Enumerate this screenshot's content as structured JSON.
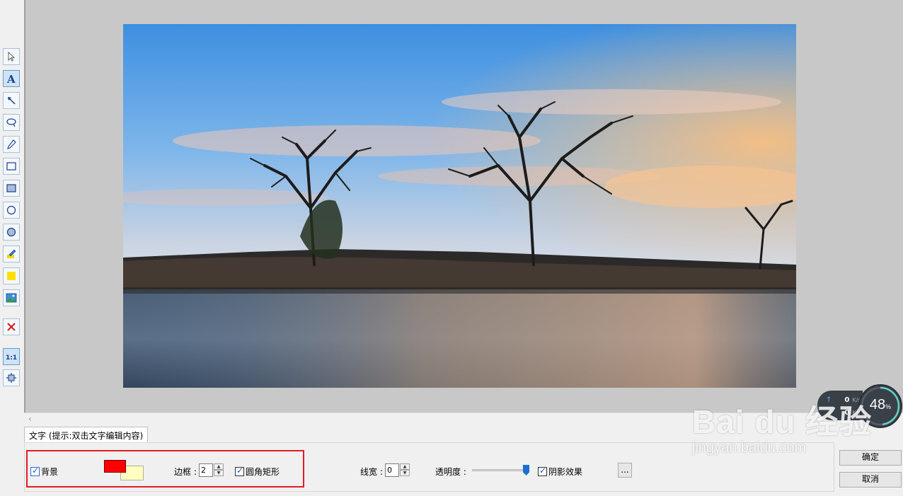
{
  "toolbar": {
    "tools": [
      {
        "id": "select",
        "icon": "cursor-icon"
      },
      {
        "id": "text",
        "icon": "text-icon",
        "active": true
      },
      {
        "id": "arrow",
        "icon": "arrow-icon"
      },
      {
        "id": "ellipse-callout",
        "icon": "lasso-icon"
      },
      {
        "id": "pen",
        "icon": "pen-icon"
      },
      {
        "id": "rect",
        "icon": "rectangle-icon"
      },
      {
        "id": "filled-rect",
        "icon": "filled-rectangle-icon"
      },
      {
        "id": "circle",
        "icon": "circle-icon"
      },
      {
        "id": "filled-circle",
        "icon": "filled-circle-icon"
      },
      {
        "id": "highlighter",
        "icon": "highlighter-icon"
      },
      {
        "id": "fill-rect",
        "icon": "yellow-square-icon"
      },
      {
        "id": "image",
        "icon": "image-icon"
      },
      {
        "id": "delete",
        "icon": "delete-icon"
      },
      {
        "id": "actual-size",
        "icon": "actual-size-icon",
        "label": "1:1",
        "active": true
      },
      {
        "id": "fit",
        "icon": "fit-window-icon"
      }
    ]
  },
  "speed_widget": {
    "up_value": "0",
    "up_unit": "K/s",
    "down_value": "0",
    "down_unit": "K/s",
    "percent": "48",
    "percent_sign": "%",
    "percent_fraction": 0.48
  },
  "panel": {
    "tab_label": "文字 (提示:双击文字编辑内容)",
    "background_label": "背景",
    "background_checked": true,
    "fg_color": "#ff0000",
    "bg_color": "#ffffc0",
    "border_label": "边框 :",
    "border_value": "2",
    "rounded_label": "圆角矩形",
    "rounded_checked": true,
    "line_width_label": "线宽 :",
    "line_width_value": "0",
    "opacity_label": "透明度 :",
    "opacity_fraction": 1.0,
    "shadow_label": "阴影效果",
    "shadow_checked": true,
    "more_label": "..."
  },
  "buttons": {
    "ok": "确定",
    "cancel": "取消"
  },
  "watermark": {
    "brand": "Bai du 经验",
    "url": "jingyan.baidu.com"
  },
  "colors": {
    "highlight_border": "#e01c24",
    "canvas_bg": "#c8c8c8"
  }
}
